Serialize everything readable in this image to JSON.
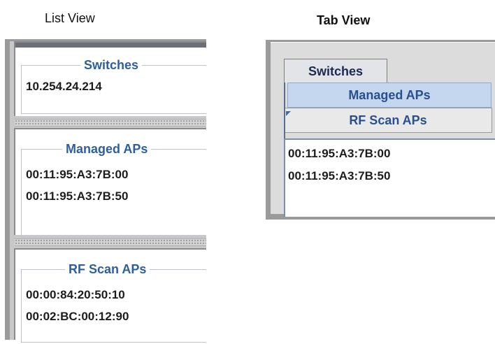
{
  "list_view": {
    "caption": "List View",
    "sections": [
      {
        "title": "Switches",
        "items": [
          "10.254.24.214"
        ]
      },
      {
        "title": "Managed APs",
        "items": [
          "00:11:95:A3:7B:00",
          "00:11:95:A3:7B:50"
        ]
      },
      {
        "title": "RF Scan APs",
        "items": [
          "00:00:84:20:50:10",
          "00:02:BC:00:12:90"
        ]
      }
    ]
  },
  "tab_view": {
    "caption": "Tab View",
    "tabs": [
      {
        "label": "Switches"
      },
      {
        "label": "Managed APs"
      },
      {
        "label": "RF Scan APs"
      }
    ],
    "selected_tab": "Managed APs",
    "items": [
      "00:11:95:A3:7B:00",
      "00:11:95:A3:7B:50"
    ]
  },
  "colors": {
    "title_blue": "#2d5fa0",
    "selected_tab_bg": "#c5d7ef",
    "panel_gray": "#9a9a9a"
  }
}
